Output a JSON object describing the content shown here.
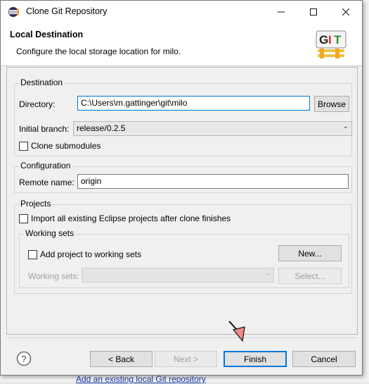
{
  "window": {
    "title": "Clone Git Repository"
  },
  "header": {
    "title": "Local Destination",
    "description": "Configure the local storage location for milo.",
    "logo_text": "GIT"
  },
  "destination": {
    "group_label": "Destination",
    "directory_label": "Directory:",
    "directory_value": "C:\\Users\\m.gattinger\\git\\milo",
    "browse_label": "Browse",
    "branch_label": "Initial branch:",
    "branch_value": "release/0.2.5",
    "clone_submodules_label": "Clone submodules",
    "clone_submodules_checked": false
  },
  "configuration": {
    "group_label": "Configuration",
    "remote_name_label": "Remote name:",
    "remote_name_value": "origin"
  },
  "projects": {
    "group_label": "Projects",
    "import_label": "Import all existing Eclipse projects after clone finishes",
    "import_checked": false,
    "working_sets": {
      "group_label": "Working sets",
      "add_label": "Add project to working sets",
      "add_checked": false,
      "new_label": "New...",
      "sets_label": "Working sets:",
      "sets_value": "",
      "select_label": "Select..."
    }
  },
  "footer": {
    "back_label": "< Back",
    "next_label": "Next >",
    "finish_label": "Finish",
    "cancel_label": "Cancel"
  },
  "background": {
    "link_text": "Add an existing local Git repository"
  },
  "colors": {
    "accent": "#0078d7",
    "disabled_text": "#a0a0a0",
    "cursor_fill": "#f08a8a"
  }
}
